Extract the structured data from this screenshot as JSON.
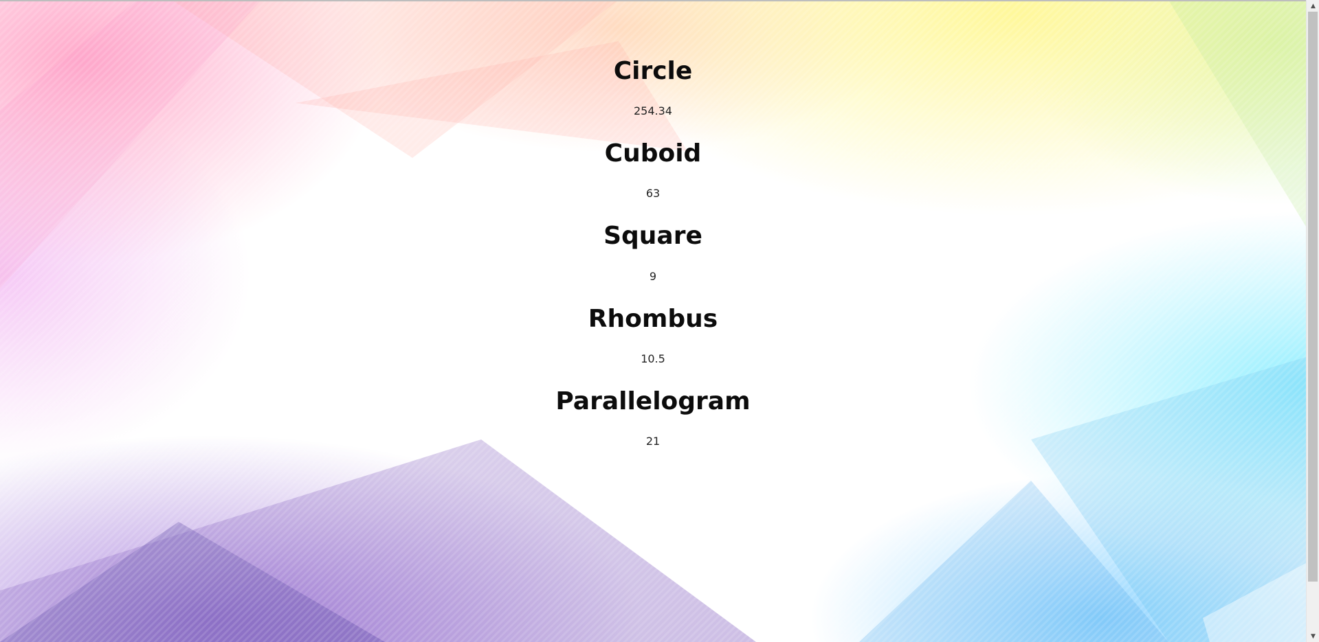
{
  "shapes": [
    {
      "name": "Circle",
      "value": "254.34"
    },
    {
      "name": "Cuboid",
      "value": "63"
    },
    {
      "name": "Square",
      "value": "9"
    },
    {
      "name": "Rhombus",
      "value": "10.5"
    },
    {
      "name": "Parallelogram",
      "value": "21"
    }
  ],
  "colors": {
    "background_warm": "#fff578",
    "background_cyan": "#78ebff",
    "background_pink": "#ff96be",
    "background_purple": "#783cc8",
    "text": "#0c0c0c",
    "scrollbar_track": "#f0f0f0",
    "scrollbar_thumb": "#c1c1c1"
  },
  "icons": {
    "scroll_up": "triangle-up-icon",
    "scroll_down": "triangle-down-icon"
  }
}
